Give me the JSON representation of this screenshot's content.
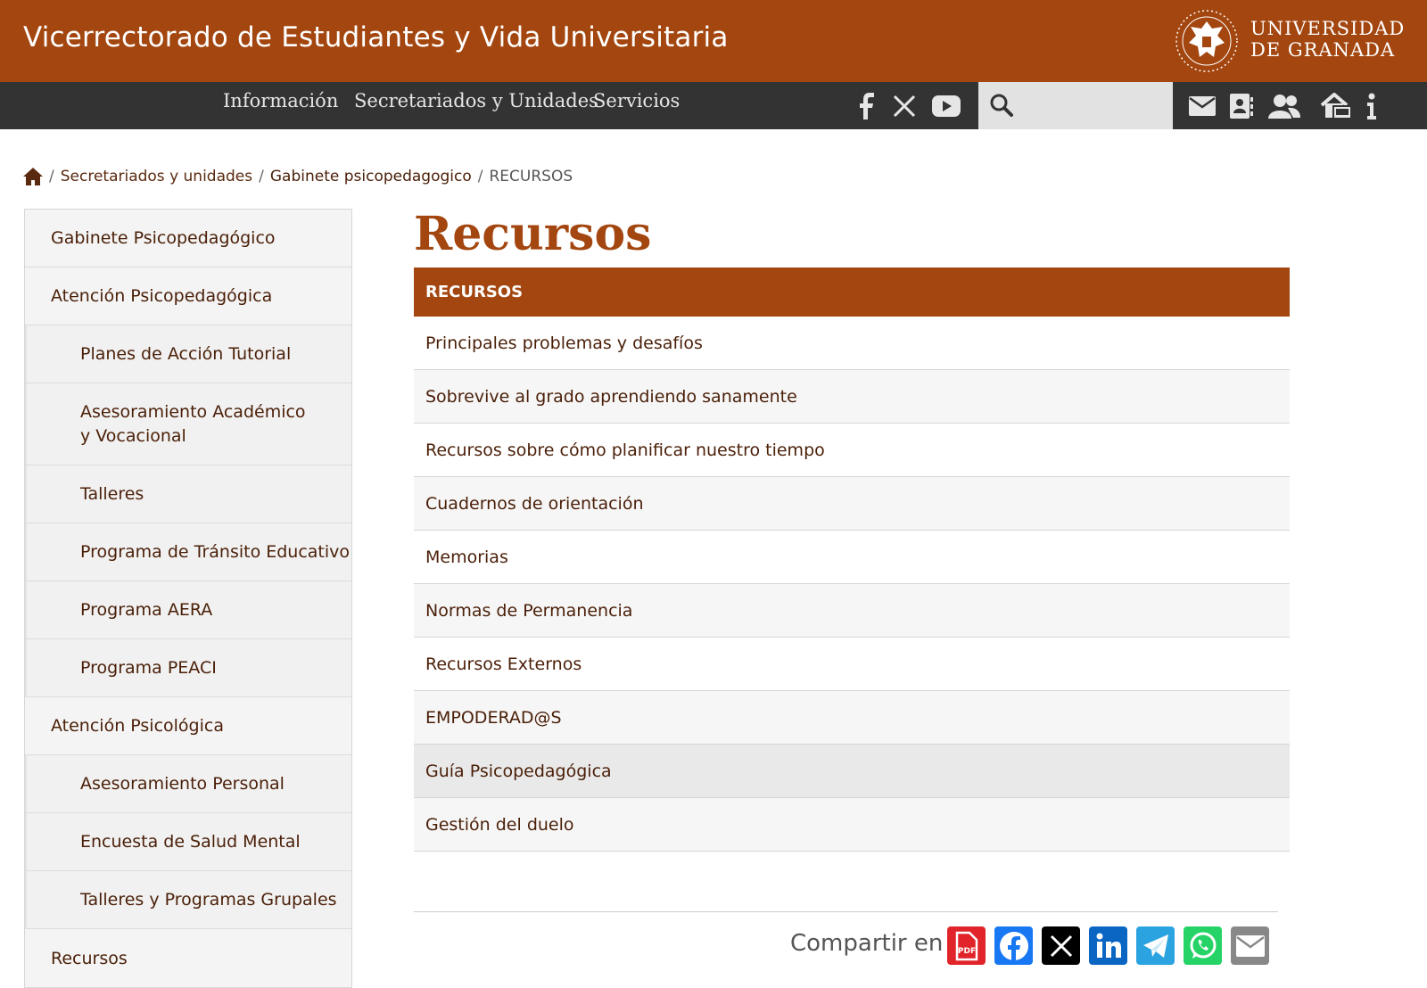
{
  "header": {
    "site_title": "Vicerrectorado de Estudiantes y Vida Universitaria",
    "university_line1": "UNIVERSIDAD",
    "university_line2": "DE GRANADA",
    "brand_color": "#a3460f"
  },
  "nav": {
    "items": [
      {
        "label": "Información"
      },
      {
        "label": "Secretariados y Unidades"
      },
      {
        "label": "Servicios"
      }
    ],
    "social_icons": [
      "facebook-icon",
      "x-icon",
      "youtube-icon"
    ],
    "search_placeholder": "",
    "utility_icons": [
      "mail-icon",
      "directory-icon",
      "users-icon",
      "intranet-icon",
      "info-icon"
    ]
  },
  "breadcrumb": {
    "home_icon": "home-icon",
    "items": [
      {
        "label": "Secretariados y unidades"
      },
      {
        "label": "Gabinete psicopedagogico"
      },
      {
        "label": "RECURSOS"
      }
    ]
  },
  "sidebar": {
    "items": [
      {
        "label": "Gabinete Psicopedagógico",
        "level": 1
      },
      {
        "label": "Atención Psicopedagógica",
        "level": 1
      },
      {
        "label": "Planes de Acción Tutorial",
        "level": 2
      },
      {
        "label": "Asesoramiento Académico y Vocacional",
        "level": 2
      },
      {
        "label": "Talleres",
        "level": 2
      },
      {
        "label": "Programa de Tránsito Educativo",
        "level": 2
      },
      {
        "label": "Programa AERA",
        "level": 2
      },
      {
        "label": "Programa PEACI",
        "level": 2
      },
      {
        "label": "Atención Psicológica",
        "level": 1
      },
      {
        "label": "Asesoramiento Personal",
        "level": 2
      },
      {
        "label": "Encuesta de Salud Mental",
        "level": 2
      },
      {
        "label": "Talleres y Programas Grupales",
        "level": 2
      },
      {
        "label": "Recursos",
        "level": 1
      }
    ]
  },
  "main": {
    "title": "Recursos",
    "list_header": "RECURSOS",
    "items": [
      {
        "label": "Principales problemas y desafíos"
      },
      {
        "label": "Sobrevive al grado aprendiendo sanamente"
      },
      {
        "label": "Recursos sobre cómo planificar nuestro tiempo"
      },
      {
        "label": "Cuadernos de orientación"
      },
      {
        "label": "Memorias"
      },
      {
        "label": "Normas de Permanencia"
      },
      {
        "label": "Recursos Externos"
      },
      {
        "label": "EMPODERAD@S"
      },
      {
        "label": "Guía Psicopedagógica"
      },
      {
        "label": "Gestión del duelo"
      }
    ],
    "hovered_index": 8
  },
  "share": {
    "label": "Compartir en",
    "buttons": [
      {
        "icon": "pdf-icon",
        "color": "#e0242a"
      },
      {
        "icon": "facebook-icon",
        "color": "#1877f2"
      },
      {
        "icon": "x-icon",
        "color": "#000000"
      },
      {
        "icon": "linkedin-icon",
        "color": "#0a66c2"
      },
      {
        "icon": "telegram-icon",
        "color": "#2aa3e0"
      },
      {
        "icon": "whatsapp-icon",
        "color": "#25d366"
      },
      {
        "icon": "email-icon",
        "color": "#888888"
      }
    ]
  }
}
